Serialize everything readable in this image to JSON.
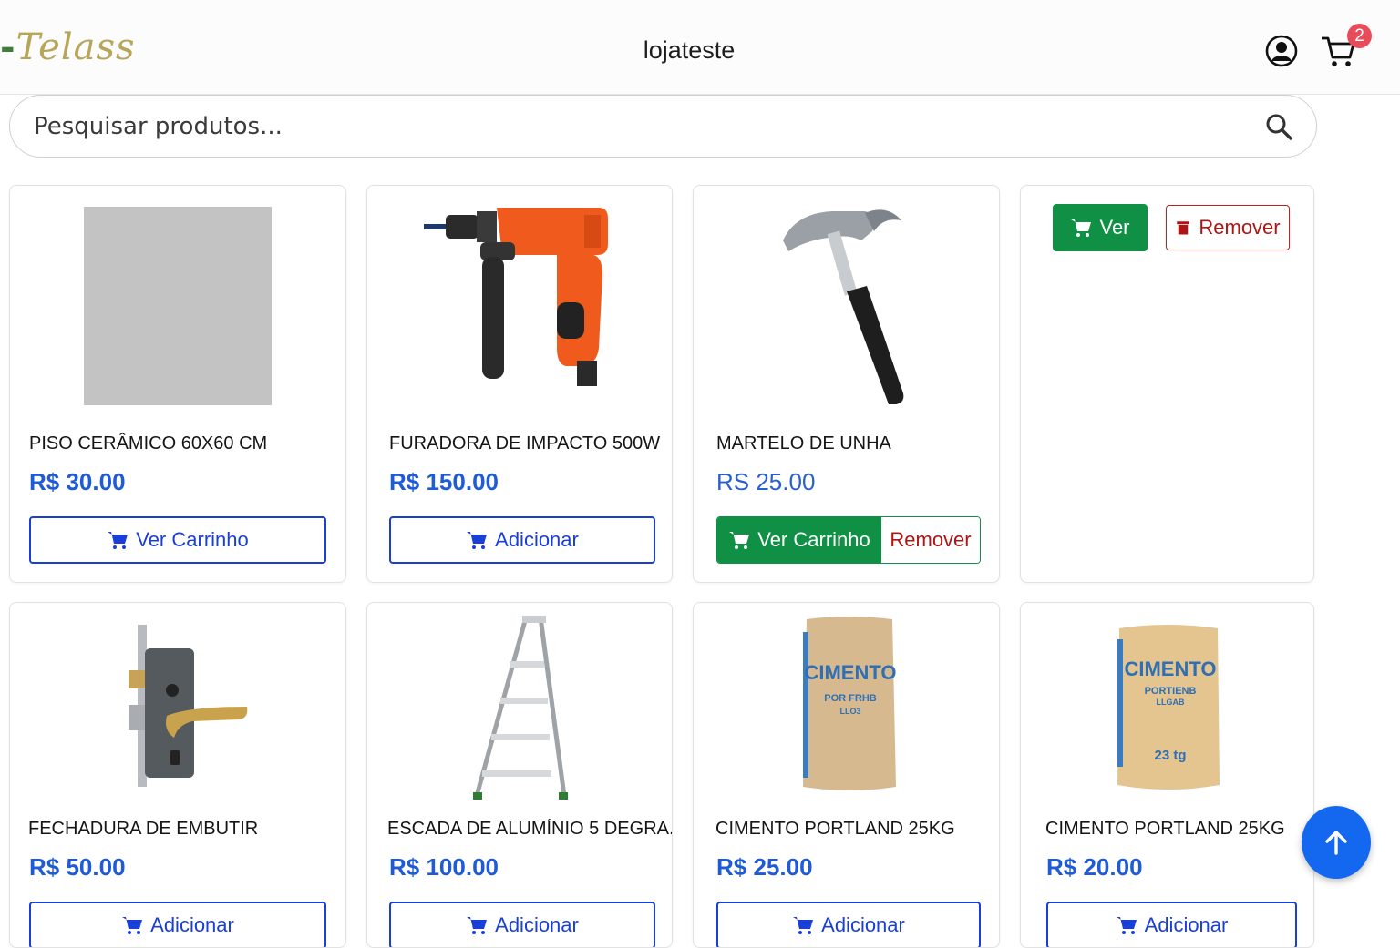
{
  "header": {
    "logo_text": "Telass",
    "store_name": "lojateste",
    "cart_count": "2",
    "icons": {
      "user": "user-circle-icon",
      "cart": "cart-icon"
    }
  },
  "search": {
    "placeholder": "Pesquisar produtos...",
    "icon": "search-icon"
  },
  "colors": {
    "price_blue": "#1f5bd6",
    "outline_blue": "#1a3fd8",
    "green": "#109044",
    "red": "#b01515",
    "fab_blue": "#1468f0",
    "badge": "#e84c5a"
  },
  "products": [
    {
      "title": "PISO CERÂMICO 60X60 CM",
      "price": "R$ 30.00",
      "button": "Ver Carrinho"
    },
    {
      "title": "FURADORA DE IMPACTO 500W",
      "price": "R$ 150.00",
      "button": "Adicionar"
    },
    {
      "title": "MARTELO DE UNHA",
      "price": "RS 25.00",
      "button_left": "Ver Carrinho",
      "button_right": "Remover"
    },
    {
      "title": "",
      "price": "",
      "button_left": "Ver",
      "button_right": "Remover"
    },
    {
      "title": "FECHADURA DE EMBUTIR",
      "price": "R$ 50.00",
      "button": "Adicionar"
    },
    {
      "title": "ESCADA DE ALUMÍNIO 5 DEGRA...",
      "price": "R$ 100.00",
      "button": "Adicionar"
    },
    {
      "title": "CIMENTO PORTLAND 25KG",
      "price": "R$ 25.00",
      "button": "Adicionar"
    },
    {
      "title": "CIMENTO PORTLAND 25KG",
      "price": "R$ 20.00",
      "button": "Adicionar"
    }
  ],
  "bag_labels": {
    "a_brand": "CIMENTO",
    "a_sub1": "POR FRHB",
    "a_sub2": "LLO3",
    "b_brand": "CIMENTO",
    "b_sub1": "PORTIENB",
    "b_sub2": "LLGAB",
    "b_weight": "23 tg"
  },
  "fab": {
    "icon": "arrow-up-icon"
  }
}
